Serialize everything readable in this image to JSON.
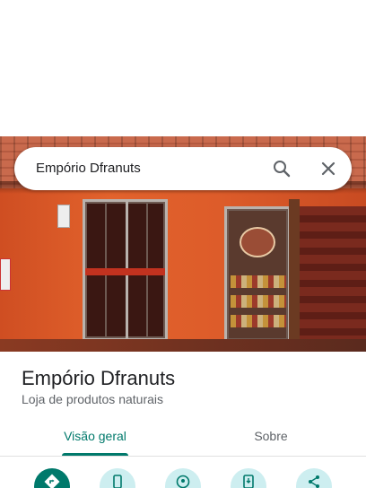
{
  "search": {
    "query": "Empório Dfranuts"
  },
  "place": {
    "name": "Empório Dfranuts",
    "category": "Loja de produtos naturais"
  },
  "tabs": [
    {
      "label": "Visão geral",
      "active": true
    },
    {
      "label": "Sobre",
      "active": false
    }
  ],
  "actions": [
    {
      "icon": "directions-icon"
    },
    {
      "icon": "phone-icon"
    },
    {
      "icon": "nearby-icon"
    },
    {
      "icon": "save-to-phone-icon"
    },
    {
      "icon": "share-icon"
    }
  ],
  "colors": {
    "accent": "#00796b",
    "action_bg": "#cdeef0",
    "title": "#202124",
    "secondary": "#5f6368"
  }
}
